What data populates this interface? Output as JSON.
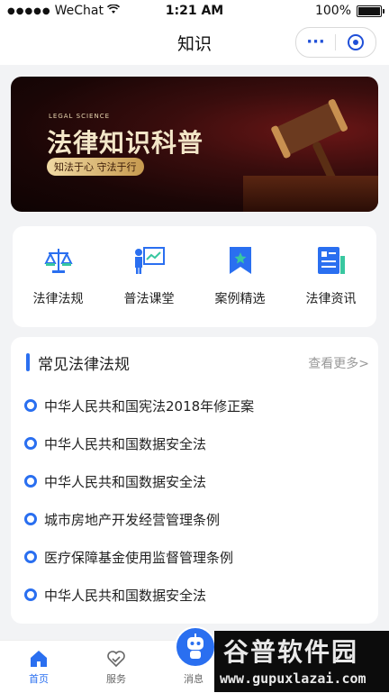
{
  "status_bar": {
    "carrier": "WeChat",
    "time": "1:21 AM",
    "battery": "100%"
  },
  "navbar": {
    "title": "知识",
    "more_label": "···"
  },
  "banner": {
    "small_text": "LEGAL SCIENCE",
    "title": "法律知识科普",
    "tag": "知法于心 守法于行"
  },
  "grid": {
    "items": [
      {
        "label": "法律法规",
        "icon": "scales-icon"
      },
      {
        "label": "普法课堂",
        "icon": "lecture-icon"
      },
      {
        "label": "案例精选",
        "icon": "bookmark-star-icon"
      },
      {
        "label": "法律资讯",
        "icon": "news-icon"
      }
    ]
  },
  "law_list": {
    "title": "常见法律法规",
    "more": "查看更多>",
    "items": [
      "中华人民共和国宪法2018年修正案",
      "中华人民共和国数据安全法",
      "中华人民共和国数据安全法",
      "城市房地产开发经营管理条例",
      "医疗保障基金使用监督管理条例",
      "中华人民共和国数据安全法"
    ]
  },
  "tabbar": {
    "tabs": [
      {
        "label": "首页"
      },
      {
        "label": "服务"
      },
      {
        "label": "消息"
      }
    ]
  },
  "watermark": {
    "line1": "谷普软件园",
    "line2": "www.gupuxlazai.com"
  },
  "colors": {
    "accent": "#2a6ff0",
    "banner_bg": "#2a0808"
  }
}
